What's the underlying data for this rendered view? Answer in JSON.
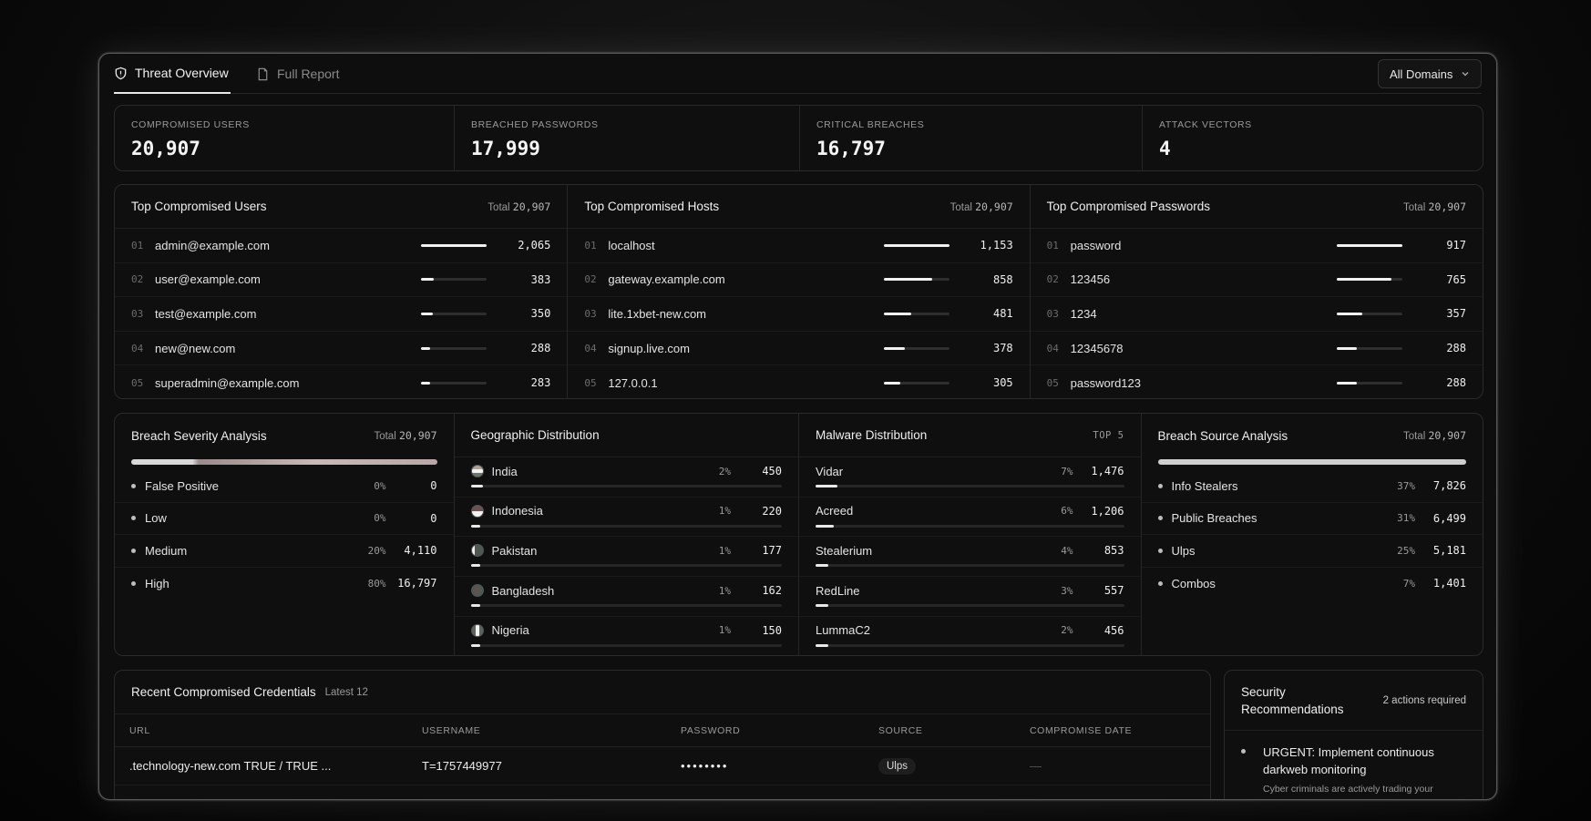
{
  "tabs": [
    {
      "label": "Threat Overview",
      "icon": "shield-icon",
      "active": true
    },
    {
      "label": "Full Report",
      "icon": "document-icon",
      "active": false
    }
  ],
  "domain_filter": {
    "selected": "All Domains"
  },
  "stats": [
    {
      "label": "COMPROMISED USERS",
      "value": "20,907"
    },
    {
      "label": "BREACHED PASSWORDS",
      "value": "17,999"
    },
    {
      "label": "CRITICAL BREACHES",
      "value": "16,797"
    },
    {
      "label": "ATTACK VECTORS",
      "value": "4"
    }
  ],
  "top_lists": [
    {
      "title": "Top Compromised Users",
      "total_label": "Total",
      "total": "20,907",
      "items": [
        {
          "index": "01",
          "name": "admin@example.com",
          "count": "2,065",
          "share": 1.0
        },
        {
          "index": "02",
          "name": "user@example.com",
          "count": "383",
          "share": 0.19
        },
        {
          "index": "03",
          "name": "test@example.com",
          "count": "350",
          "share": 0.17
        },
        {
          "index": "04",
          "name": "new@new.com",
          "count": "288",
          "share": 0.14
        },
        {
          "index": "05",
          "name": "superadmin@example.com",
          "count": "283",
          "share": 0.14
        }
      ]
    },
    {
      "title": "Top Compromised Hosts",
      "total_label": "Total",
      "total": "20,907",
      "items": [
        {
          "index": "01",
          "name": "localhost",
          "count": "1,153",
          "share": 1.0
        },
        {
          "index": "02",
          "name": "gateway.example.com",
          "count": "858",
          "share": 0.74
        },
        {
          "index": "03",
          "name": "lite.1xbet-new.com",
          "count": "481",
          "share": 0.42
        },
        {
          "index": "04",
          "name": "signup.live.com",
          "count": "378",
          "share": 0.33
        },
        {
          "index": "05",
          "name": "127.0.0.1",
          "count": "305",
          "share": 0.26
        }
      ]
    },
    {
      "title": "Top Compromised Passwords",
      "total_label": "Total",
      "total": "20,907",
      "items": [
        {
          "index": "01",
          "name": "password",
          "count": "917",
          "share": 1.0
        },
        {
          "index": "02",
          "name": "123456",
          "count": "765",
          "share": 0.83
        },
        {
          "index": "03",
          "name": "1234",
          "count": "357",
          "share": 0.39
        },
        {
          "index": "04",
          "name": "12345678",
          "count": "288",
          "share": 0.31
        },
        {
          "index": "05",
          "name": "password123",
          "count": "288",
          "share": 0.31
        }
      ]
    }
  ],
  "severity": {
    "title": "Breach Severity Analysis",
    "total_label": "Total",
    "total": "20,907",
    "items": [
      {
        "label": "False Positive",
        "pct": "0%",
        "count": "0"
      },
      {
        "label": "Low",
        "pct": "0%",
        "count": "0"
      },
      {
        "label": "Medium",
        "pct": "20%",
        "count": "4,110"
      },
      {
        "label": "High",
        "pct": "80%",
        "count": "16,797"
      }
    ]
  },
  "geo": {
    "title": "Geographic Distribution",
    "items": [
      {
        "label": "India",
        "pct": "2%",
        "count": "450",
        "fill": 0.04
      },
      {
        "label": "Indonesia",
        "pct": "1%",
        "count": "220",
        "fill": 0.03
      },
      {
        "label": "Pakistan",
        "pct": "1%",
        "count": "177",
        "fill": 0.03
      },
      {
        "label": "Bangladesh",
        "pct": "1%",
        "count": "162",
        "fill": 0.03
      },
      {
        "label": "Nigeria",
        "pct": "1%",
        "count": "150",
        "fill": 0.03
      }
    ]
  },
  "malware": {
    "title": "Malware Distribution",
    "badge": "TOP 5",
    "items": [
      {
        "label": "Vidar",
        "pct": "7%",
        "count": "1,476",
        "fill": 0.07
      },
      {
        "label": "Acreed",
        "pct": "6%",
        "count": "1,206",
        "fill": 0.06
      },
      {
        "label": "Stealerium",
        "pct": "4%",
        "count": "853",
        "fill": 0.04
      },
      {
        "label": "RedLine",
        "pct": "3%",
        "count": "557",
        "fill": 0.04
      },
      {
        "label": "LummaC2",
        "pct": "2%",
        "count": "456",
        "fill": 0.04
      }
    ]
  },
  "source": {
    "title": "Breach Source Analysis",
    "total_label": "Total",
    "total": "20,907",
    "items": [
      {
        "label": "Info Stealers",
        "pct": "37%",
        "count": "7,826"
      },
      {
        "label": "Public Breaches",
        "pct": "31%",
        "count": "6,499"
      },
      {
        "label": "Ulps",
        "pct": "25%",
        "count": "5,181"
      },
      {
        "label": "Combos",
        "pct": "7%",
        "count": "1,401"
      }
    ]
  },
  "credentials": {
    "title": "Recent Compromised Credentials",
    "latest": "Latest 12",
    "columns": [
      "URL",
      "USERNAME",
      "PASSWORD",
      "SOURCE",
      "COMPROMISE DATE"
    ],
    "rows": [
      {
        "url": ".technology-new.com TRUE / TRUE ...",
        "username": "T=1757449977",
        "password": "••••••••",
        "source": "Ulps",
        "date": "—"
      }
    ]
  },
  "recommendations": {
    "title": "Security Recommendations",
    "count": "2 actions required",
    "items": [
      {
        "title": "URGENT: Implement continuous darkweb monitoring",
        "desc": "Cyber criminals are actively trading your"
      }
    ]
  }
}
